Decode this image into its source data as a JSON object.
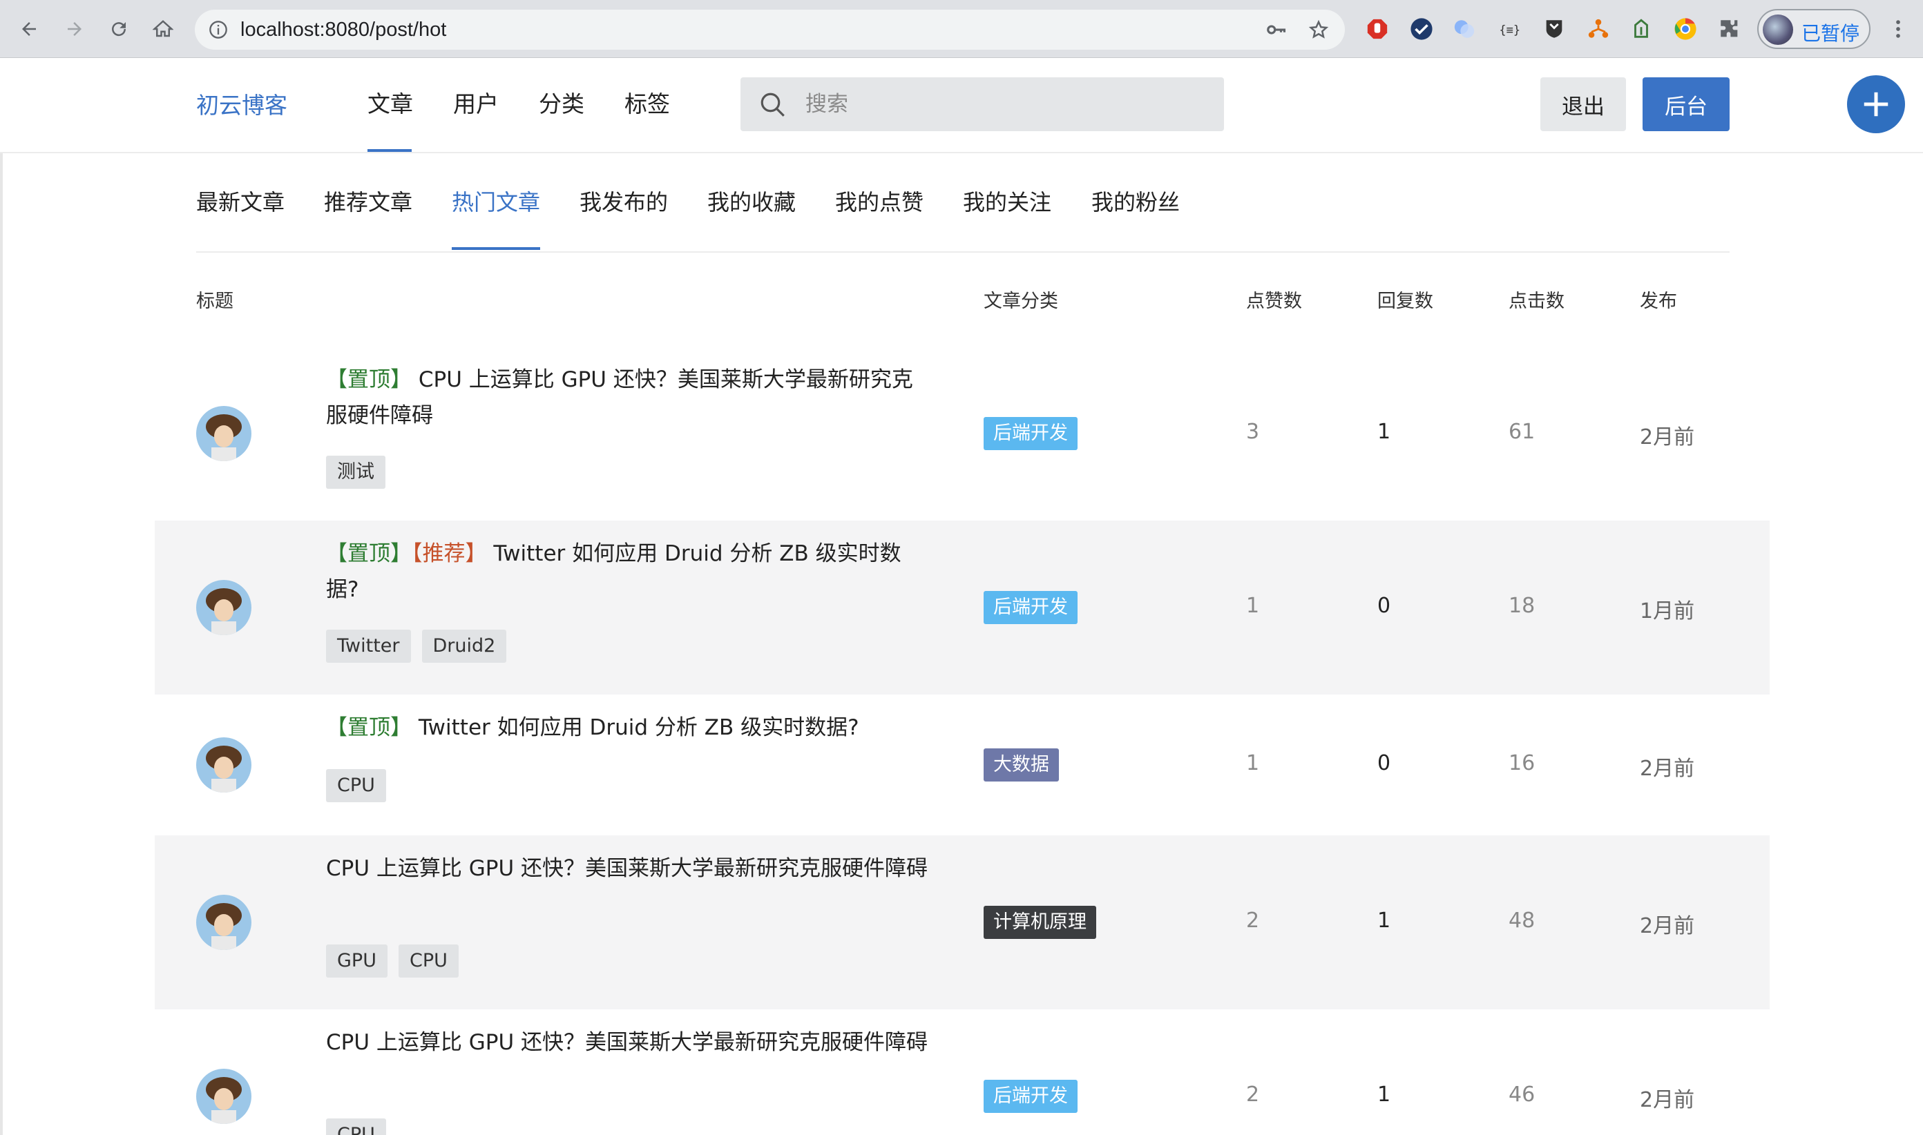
{
  "browser": {
    "url": "localhost:8080/post/hot",
    "profile_status": "已暂停"
  },
  "header": {
    "logo": "初云博客",
    "nav": [
      "文章",
      "用户",
      "分类",
      "标签"
    ],
    "search_placeholder": "搜索",
    "logout_label": "退出",
    "admin_label": "后台"
  },
  "subtabs": [
    "最新文章",
    "推荐文章",
    "热门文章",
    "我发布的",
    "我的收藏",
    "我的点赞",
    "我的关注",
    "我的粉丝"
  ],
  "table": {
    "columns": [
      "标题",
      "文章分类",
      "点赞数",
      "回复数",
      "点击数",
      "发布"
    ],
    "rows": [
      {
        "prefix_top": "【置顶】",
        "prefix_rec": "",
        "title": "CPU 上运算比 GPU 还快？美国莱斯大学最新研究克服硬件障碍",
        "tags": [
          "测试"
        ],
        "category": "后端开发",
        "category_color": "#5bb8f0",
        "likes": "3",
        "replies": "1",
        "views": "61",
        "time": "2月前"
      },
      {
        "prefix_top": "【置顶】",
        "prefix_rec": "【推荐】",
        "title": "Twitter 如何应用 Druid 分析 ZB 级实时数据?",
        "tags": [
          "Twitter",
          "Druid2"
        ],
        "category": "后端开发",
        "category_color": "#5bb8f0",
        "likes": "1",
        "replies": "0",
        "views": "18",
        "time": "1月前"
      },
      {
        "prefix_top": "【置顶】",
        "prefix_rec": "",
        "title": "Twitter 如何应用 Druid 分析 ZB 级实时数据?",
        "tags": [
          "CPU"
        ],
        "category": "大数据",
        "category_color": "#6e78a8",
        "likes": "1",
        "replies": "0",
        "views": "16",
        "time": "2月前"
      },
      {
        "prefix_top": "",
        "prefix_rec": "",
        "title": "CPU 上运算比 GPU 还快？美国莱斯大学最新研究克服硬件障碍",
        "tags": [
          "GPU",
          "CPU"
        ],
        "category": "计算机原理",
        "category_color": "#3b3d40",
        "likes": "2",
        "replies": "1",
        "views": "48",
        "time": "2月前"
      },
      {
        "prefix_top": "",
        "prefix_rec": "",
        "title": "CPU 上运算比 GPU 还快？美国莱斯大学最新研究克服硬件障碍",
        "tags": [
          "CPU"
        ],
        "category": "后端开发",
        "category_color": "#5bb8f0",
        "likes": "2",
        "replies": "1",
        "views": "46",
        "time": "2月前"
      }
    ]
  },
  "icons": {
    "accent": "#3a73c6"
  }
}
